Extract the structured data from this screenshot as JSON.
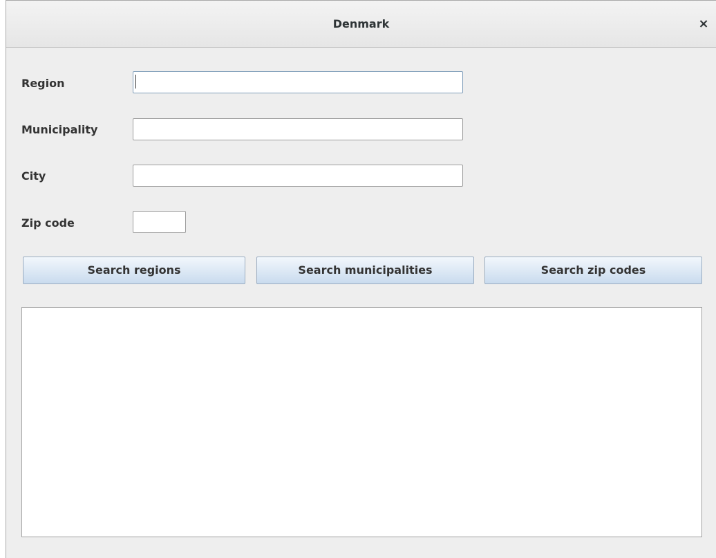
{
  "window": {
    "title": "Denmark",
    "close_glyph": "×"
  },
  "form": {
    "region": {
      "label": "Region",
      "value": ""
    },
    "municipality": {
      "label": "Municipality",
      "value": ""
    },
    "city": {
      "label": "City",
      "value": ""
    },
    "zip_code": {
      "label": "Zip code",
      "value": ""
    }
  },
  "buttons": {
    "search_regions": "Search regions",
    "search_municipalities": "Search municipalities",
    "search_zip_codes": "Search zip codes"
  },
  "results": {
    "items": []
  },
  "colors": {
    "window_bg": "#eeeeee",
    "button_gradient_top": "#f2f7fc",
    "button_gradient_bottom": "#c9dbee"
  }
}
